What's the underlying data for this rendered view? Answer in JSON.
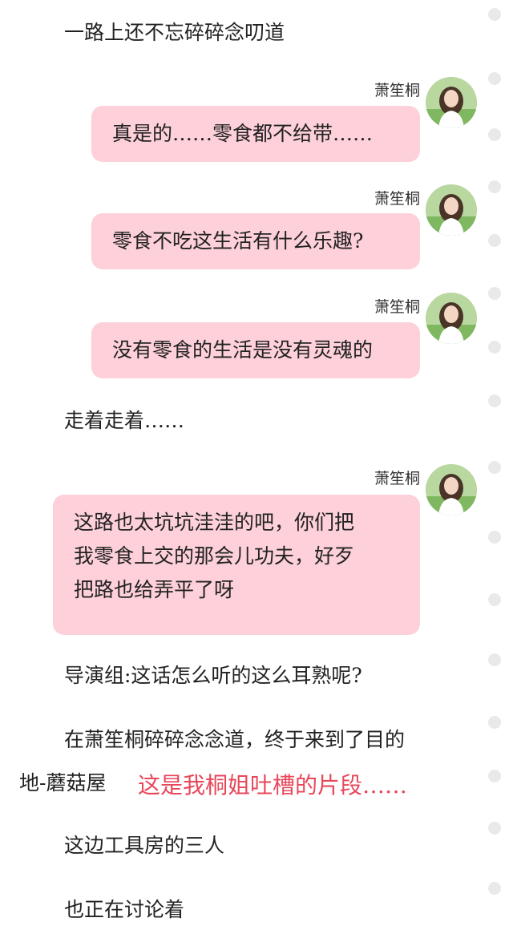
{
  "narration_1": "一路上还不忘碎碎念叨道",
  "speaker_name": "萧笙桐",
  "messages": [
    {
      "lines": [
        "真是的……零食都不给带……"
      ]
    },
    {
      "lines": [
        "零食不吃这生活有什么乐趣?"
      ]
    },
    {
      "lines": [
        "没有零食的生活是没有灵魂的"
      ]
    },
    {
      "lines": [
        "这路也太坑坑洼洼的吧，你们把",
        "我零食上交的那会儿功夫，好歹",
        "把路也给弄平了呀"
      ]
    }
  ],
  "narration_2": "走着走着……",
  "narration_3": "导演组:这话怎么听的这么耳熟呢?",
  "narration_4_line1": "在萧笙桐碎碎念念道，终于来到了目的",
  "narration_4_line2": "地-蘑菇屋",
  "red_comment": "这是我桐姐吐槽的片段……",
  "narration_5": "这边工具房的三人",
  "narration_6": "也正在讨论着",
  "colors": {
    "bubble": "#fdd0da",
    "red_comment": "#e8475a",
    "scroll_dot": "#e9e9e9"
  }
}
